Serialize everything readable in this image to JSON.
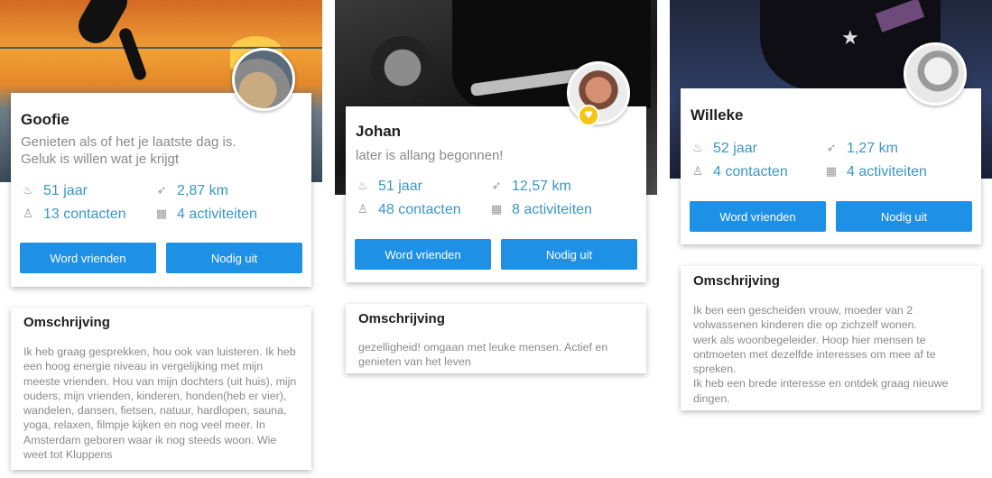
{
  "profiles": [
    {
      "name": "Goofie",
      "tagline": "Genieten als of het je laatste dag is.\nGeluk is willen wat je krijgt",
      "age": "51 jaar",
      "distance": "2,87 km",
      "contacts": "13 contacten",
      "activities": "4 activiteiten",
      "friend_button": "Word vrienden",
      "invite_button": "Nodig uit",
      "description_title": "Omschrijving",
      "description": "Ik heb graag gesprekken, hou ook van luisteren. Ik heb een hoog energie niveau in vergelijking met mijn meeste vrienden. Hou van mijn dochters (uit huis), mijn ouders, mijn vrienden, kinderen, honden(heb er vier), wandelen, dansen, fietsen, natuur, hardlopen, sauna, yoga, relaxen, filmpje kijken en nog veel meer. In Amsterdam geboren waar ik nog steeds woon. Wie weet tot Kluppens"
    },
    {
      "name": "Johan",
      "tagline": "later is allang begonnen!",
      "age": "51 jaar",
      "distance": "12,57 km",
      "contacts": "48 contacten",
      "activities": "8 activiteiten",
      "friend_button": "Word vrienden",
      "invite_button": "Nodig uit",
      "description_title": "Omschrijving",
      "description": "gezelligheid! omgaan met leuke mensen. Actief en genieten van het leven"
    },
    {
      "name": "Willeke",
      "tagline": "",
      "age": "52 jaar",
      "distance": "1,27 km",
      "contacts": "4 contacten",
      "activities": "4 activiteiten",
      "friend_button": "Word vrienden",
      "invite_button": "Nodig uit",
      "description_title": "Omschrijving",
      "description": "Ik ben een gescheiden vrouw, moeder van 2 volwassenen kinderen die op zichzelf wonen.\nwerk als woonbegeleider.  Hoop hier mensen te ontmoeten met dezelfde interesses om mee af te spreken.\nIk heb een brede interesse en ontdek graag nieuwe dingen."
    }
  ],
  "icons": {
    "age": "birthday-cake-icon",
    "distance": "location-arrow-icon",
    "contacts": "contacts-icon",
    "activities": "calendar-icon",
    "badge": "heart-badge-icon"
  },
  "colors": {
    "accent": "#1e90e6",
    "stat_text": "#3a97c4",
    "badge": "#f5c518"
  }
}
